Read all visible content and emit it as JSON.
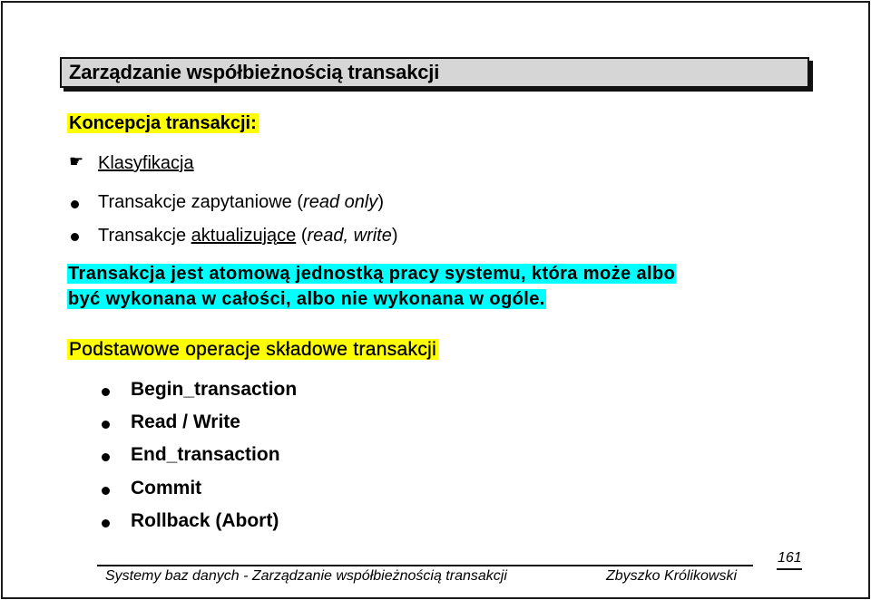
{
  "slide": {
    "title": "Zarządzanie współbieżnością transakcji",
    "section1": {
      "heading": "Koncepcja transakcji:",
      "pointer_icon": "pointing-hand-icon",
      "subheading": "Klasyfikacja",
      "items": [
        {
          "prefix": "Transakcje zapytaniowe (",
          "emphasis": "read only",
          "suffix": ")"
        },
        {
          "prefix": "Transakcje ",
          "underlined": "aktualizujące",
          "middle": " (",
          "emphasis": "read, write",
          "suffix": ")"
        }
      ]
    },
    "definition": {
      "line1": "Transakcja jest atomową jednostką pracy systemu, która może albo",
      "line2": "być wykonana w całości, albo nie wykonana w ogóle."
    },
    "section2": {
      "heading": "Podstawowe operacje składowe transakcji",
      "items": [
        "Begin_transaction",
        "Read / Write",
        "End_transaction",
        "Commit",
        "Rollback (Abort)"
      ]
    },
    "footer": {
      "course": "Systemy baz danych - Zarządzanie współbieżnością transakcji",
      "author": "Zbyszko Królikowski",
      "page_number": "161"
    },
    "colors": {
      "heading_highlight": "#ffff00",
      "definition_highlight": "#00ffff",
      "title_box_bg": "#d6d6d6"
    }
  }
}
